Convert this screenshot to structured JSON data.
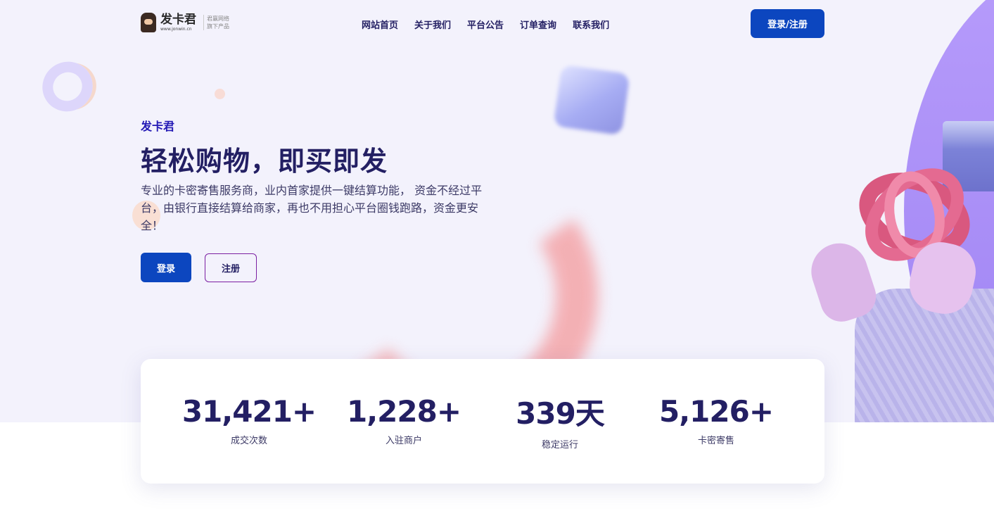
{
  "header": {
    "logo_title": "发卡君",
    "logo_url": "www.jonwin.cn",
    "logo_sub_line1": "君赢网络",
    "logo_sub_line2": "旗下产品",
    "nav": [
      "网站首页",
      "关于我们",
      "平台公告",
      "订单查询",
      "联系我们"
    ],
    "login_register_label": "登录/注册"
  },
  "hero": {
    "brand": "发卡君",
    "headline": "轻松购物，即买即发",
    "description": "专业的卡密寄售服务商，业内首家提供一键结算功能， 资金不经过平台，由银行直接结算给商家，再也不用担心平台圈钱跑路，资金更安全！",
    "login_label": "登录",
    "register_label": "注册"
  },
  "stats": [
    {
      "value": "31,421+",
      "label": "成交次数"
    },
    {
      "value": "1,228+",
      "label": "入驻商户"
    },
    {
      "value": "339天",
      "label": "稳定运行"
    },
    {
      "value": "5,126+",
      "label": "卡密寄售"
    }
  ],
  "colors": {
    "primary": "#0c46bf",
    "text_dark": "#231f63",
    "brand_accent": "#2319b5",
    "hero_bg": "#f3f2fc"
  }
}
